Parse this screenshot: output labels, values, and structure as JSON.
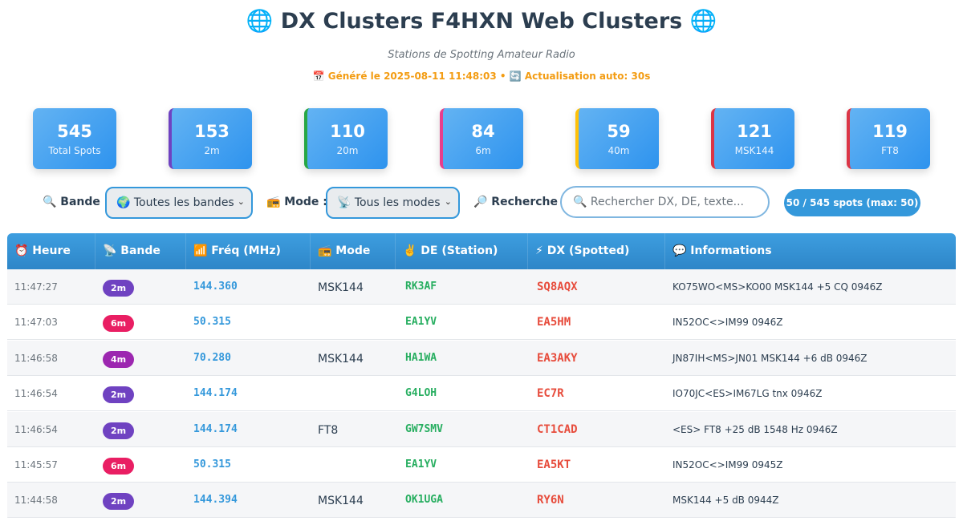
{
  "header": {
    "title": "🌐 DX Clusters F4HXN Web Clusters 🌐",
    "subtitle": "Stations de Spotting Amateur Radio",
    "generated": "📅 Généré le 2025-08-11 11:48:03 • 🔄 Actualisation auto: 30s"
  },
  "stats": [
    {
      "value": "545",
      "label": "Total Spots",
      "accent": "#2e93ee"
    },
    {
      "value": "153",
      "label": "2m",
      "accent": "#6f42c1"
    },
    {
      "value": "110",
      "label": "20m",
      "accent": "#28a745"
    },
    {
      "value": "84",
      "label": "6m",
      "accent": "#e83e8c"
    },
    {
      "value": "59",
      "label": "40m",
      "accent": "#ffc107"
    },
    {
      "value": "121",
      "label": "MSK144",
      "accent": "#dc3545"
    },
    {
      "value": "119",
      "label": "FT8",
      "accent": "#dc3545"
    }
  ],
  "filters": {
    "band_label": "🔍 Bande :",
    "band_value": "🌍 Toutes les bandes",
    "mode_label": "📻 Mode :",
    "mode_value": "📡 Tous les modes",
    "search_label": "🔎 Recherche :",
    "search_placeholder": "🔍 Rechercher DX, DE, texte...",
    "count": "50 / 545 spots (max: 50)"
  },
  "table": {
    "headers": [
      "⏰ Heure",
      "📡 Bande",
      "📶 Fréq (MHz)",
      "📻 Mode",
      "✌️ DE (Station)",
      "⚡ DX (Spotted)",
      "💬 Informations"
    ],
    "rows": [
      {
        "time": "11:47:27",
        "band": "2m",
        "band_color": "#6f42c1",
        "freq": "144.360",
        "mode": "MSK144",
        "de": "RK3AF",
        "dx": "SQ8AQX",
        "info": "KO75WO<MS>KO00 MSK144 +5 CQ 0946Z"
      },
      {
        "time": "11:47:03",
        "band": "6m",
        "band_color": "#e91e63",
        "freq": "50.315",
        "mode": "",
        "de": "EA1YV",
        "dx": "EA5HM",
        "info": "IN52OC<>IM99 0946Z"
      },
      {
        "time": "11:46:58",
        "band": "4m",
        "band_color": "#9c27b0",
        "freq": "70.280",
        "mode": "MSK144",
        "de": "HA1WA",
        "dx": "EA3AKY",
        "info": "JN87IH<MS>JN01 MSK144 +6 dB 0946Z"
      },
      {
        "time": "11:46:54",
        "band": "2m",
        "band_color": "#6f42c1",
        "freq": "144.174",
        "mode": "",
        "de": "G4LOH",
        "dx": "EC7R",
        "info": "IO70JC<ES>IM67LG tnx 0946Z"
      },
      {
        "time": "11:46:54",
        "band": "2m",
        "band_color": "#6f42c1",
        "freq": "144.174",
        "mode": "FT8",
        "de": "GW7SMV",
        "dx": "CT1CAD",
        "info": "<ES> FT8 +25 dB 1548 Hz 0946Z"
      },
      {
        "time": "11:45:57",
        "band": "6m",
        "band_color": "#e91e63",
        "freq": "50.315",
        "mode": "",
        "de": "EA1YV",
        "dx": "EA5KT",
        "info": "IN52OC<>IM99 0945Z"
      },
      {
        "time": "11:44:58",
        "band": "2m",
        "band_color": "#6f42c1",
        "freq": "144.394",
        "mode": "MSK144",
        "de": "OK1UGA",
        "dx": "RY6N",
        "info": "MSK144 +5 dB 0944Z"
      }
    ]
  }
}
